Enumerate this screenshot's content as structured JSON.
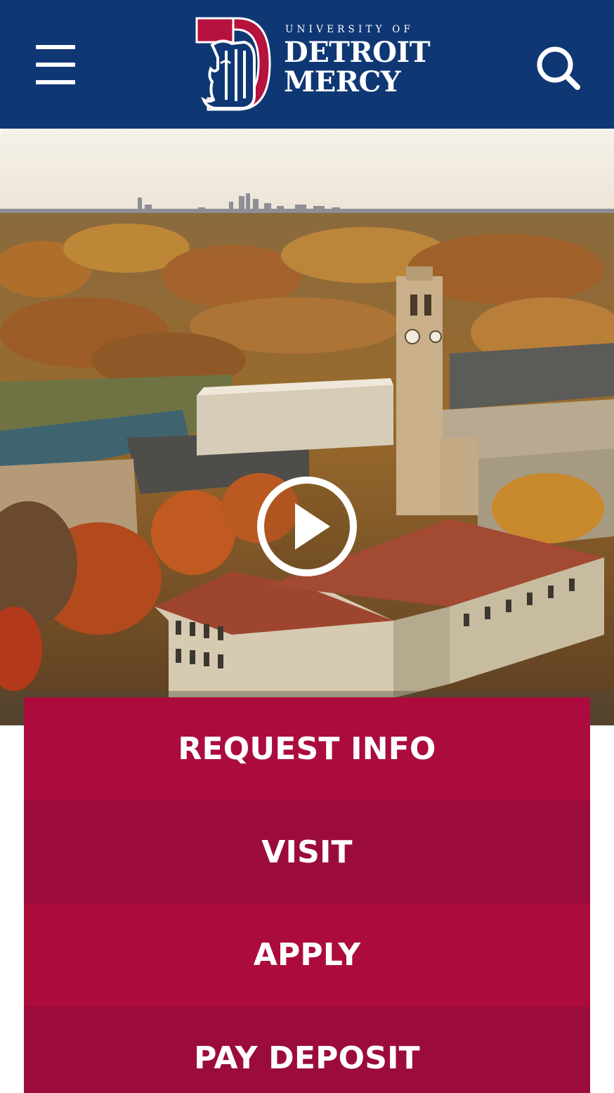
{
  "header": {
    "background_color": "#0f3774",
    "menu_icon": "hamburger-menu-icon",
    "search_icon": "search-icon",
    "logo": {
      "line_small": "UNIVERSITY OF",
      "line_1": "DETROIT",
      "line_2": "MERCY",
      "mark_colors": {
        "red": "#b5123f",
        "blue": "#0f3774",
        "white": "#ffffff"
      }
    }
  },
  "hero": {
    "image_description_icon": "campus-aerial-photo",
    "play_icon": "play-icon"
  },
  "cta": {
    "request_info": "REQUEST INFO",
    "visit": "VISIT",
    "apply": "APPLY",
    "pay_deposit": "PAY DEPOSIT",
    "colors": [
      "#ab0c3d",
      "#9c0c3b",
      "#ac0c3c",
      "#9c0c3b"
    ]
  }
}
